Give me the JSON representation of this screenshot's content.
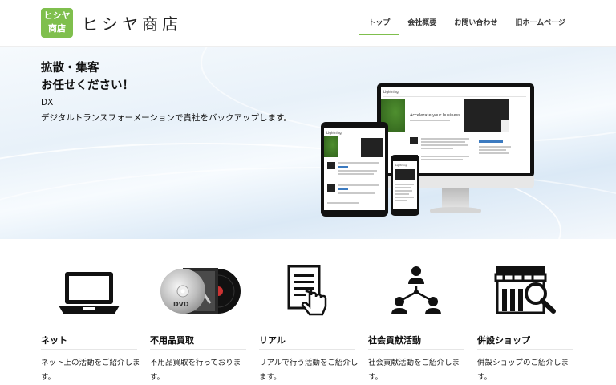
{
  "header": {
    "logo_badge_line1": "ヒシヤ",
    "logo_badge_line2": "商店",
    "logo_text": "ヒシヤ商店",
    "nav": [
      {
        "label": "トップ",
        "active": true
      },
      {
        "label": "会社概要"
      },
      {
        "label": "お問い合わせ"
      },
      {
        "label": "旧ホームページ"
      }
    ],
    "accent_color": "#7fbf4d"
  },
  "hero": {
    "title_line1": "拡散・集客",
    "title_line2": "お任せください！",
    "sub_line1": "DX",
    "sub_line2": "デジタルトランスフォーメーションで貴社をバックアップします。",
    "mockup": {
      "site_name": "Lightning",
      "headline": "Accelerate your business"
    }
  },
  "cards": [
    {
      "title": "ネット",
      "desc": "ネット上の活動をご紹介します。",
      "icon": "laptop-icon"
    },
    {
      "title": "不用品買取",
      "desc": "不用品買取を行っております。",
      "icon": "dvd-cd-icon"
    },
    {
      "title": "リアル",
      "desc": "リアルで行う活動をご紹介します。",
      "icon": "document-hand-icon"
    },
    {
      "title": "社会貢献活動",
      "desc": "社会貢献活動をご紹介します。",
      "icon": "network-people-icon"
    },
    {
      "title": "併設ショップ",
      "desc": "併設ショップのご紹介します。",
      "icon": "shop-search-icon"
    }
  ]
}
